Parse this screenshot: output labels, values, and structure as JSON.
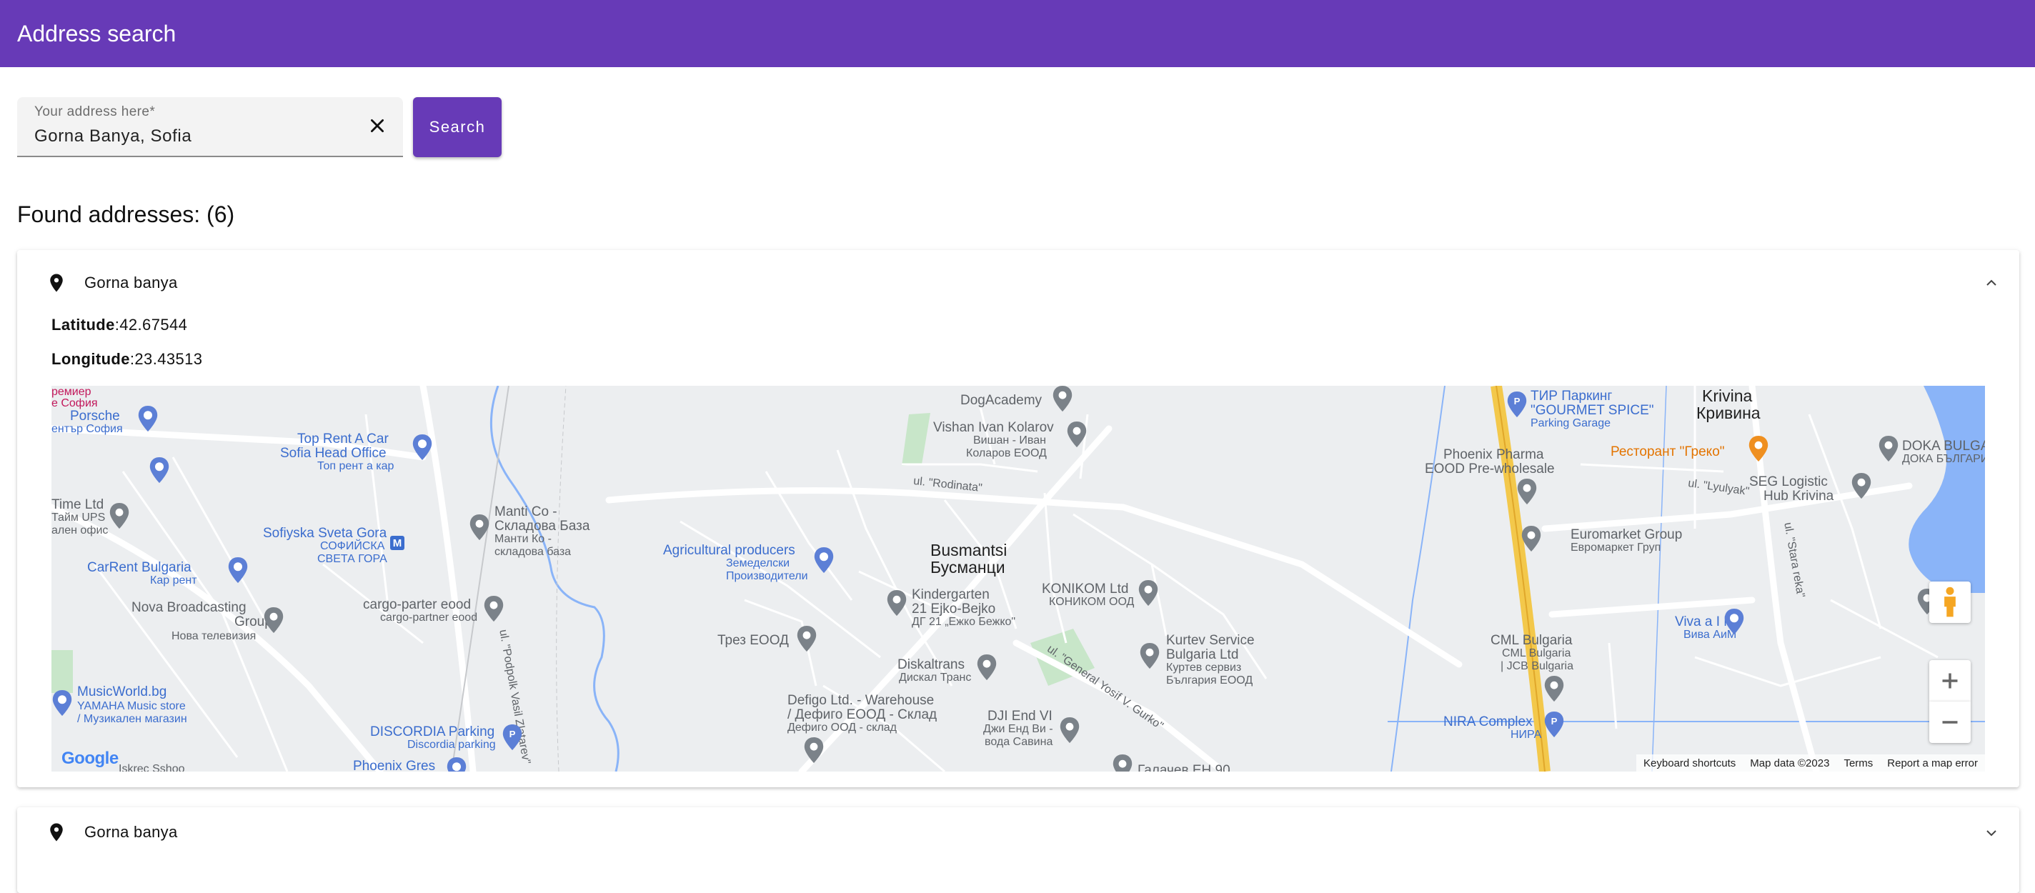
{
  "header": {
    "title": "Address search"
  },
  "search": {
    "label": "Your address here*",
    "value": "Gorna Banya, Sofia",
    "button_label": "Search"
  },
  "results": {
    "heading": "Found addresses: (6)",
    "items": [
      {
        "title": "Gorna banya",
        "latitude_label": "Latitude",
        "latitude": ":42.67544",
        "longitude_label": "Longitude",
        "longitude": ":23.43513",
        "expanded": true
      },
      {
        "title": "Gorna banya",
        "expanded": false
      }
    ]
  },
  "map": {
    "footer": {
      "shortcuts": "Keyboard shortcuts",
      "data": "Map data ©2023",
      "terms": "Terms",
      "report": "Report a map error"
    },
    "google_logo": "Google",
    "labels": {
      "premier": "ремиер",
      "premier_sofia": "е София",
      "porsche": "Porsche",
      "porsche_sub": "ентър София",
      "toprent": "Top Rent A Car",
      "toprent2": "Sofia Head Office",
      "toprent_sub": "Топ рент а кар",
      "timeltd": "Time Ltd",
      "timeltd_sub": "Тайм UPS",
      "timeltd_sub2": "ален офис",
      "sveta": "Sofiyska Sveta Gora",
      "sveta_sub": "СОФИЙСКА",
      "sveta_sub2": "СВЕТА ГОРА",
      "manti": "Manti Co -",
      "manti2": "Складова База",
      "manti_sub": "Манти Ко -",
      "manti_sub2": "складова база",
      "carrent": "CarRent Bulgaria",
      "carrent_sub": "Кар рент",
      "nova": "Nova Broadcasting",
      "nova2": "Group",
      "nova_sub": "Нова телевизия",
      "cargo": "cargo-parter eood",
      "cargo_sub": "cargo-partner eood",
      "podpolk": "ul. \"Podpolk Vasil Zlatarev\"",
      "music": "MusicWorld.bg",
      "music_sub": "YAMAHA Music store",
      "music_sub2": "/ Музикален магазин",
      "discordia": "DISCORDIA Parking",
      "discordia_sub": "Discordia parking",
      "phoenix": "Phoenix Gres",
      "iskrec": "Iskrec Sshoo",
      "dog": "DogAcademy",
      "vishan": "Vishan Ivan Kolarov",
      "vishan_sub": "Вишан - Иван",
      "vishan_sub2": "Коларов ЕООД",
      "rodinata": "ul. \"Rodinata\"",
      "agri": "Agricultural producers",
      "agri_sub": "Земеделски",
      "agri_sub2": "Производители",
      "busmantsi": "Busmantsi",
      "busmantsi_bg": "Бусманци",
      "kinder": "Kindergarten",
      "kinder2": "21 Ejko-Bejko",
      "kinder_sub": "ДГ 21 „Ежко Бежко\"",
      "konikom": "KONIKOM Ltd",
      "konikom_sub": "КОНИКОМ ООД",
      "trez": "Трез ЕООД",
      "diskal": "Diskaltrans",
      "diskal_sub": "Дискал Транс",
      "gurko": "ul. \"General Yosif V. Gurko\"",
      "defigo": "Defigo Ltd. - Warehouse",
      "defigo2": "/ Дефиго ЕООД - Склад",
      "defigo_sub": "Дефиго ООД - склад",
      "djiend": "DJI End VI",
      "djiend_sub": "Джи Енд Ви -",
      "djiend_sub2": "вода Савина",
      "kurtev": "Kurtev Service",
      "kurtev2": "Bulgaria Ltd",
      "kurtev_sub": "Куртев сервиз",
      "kurtev_sub2": "България ЕООД",
      "galachev": "Галачев ЕН 90",
      "tir": "ТИР Паркинг",
      "tir2": "\"GOURMET SPICE\"",
      "tir_sub": "Parking Garage",
      "krivina": "Krivina",
      "krivina_bg": "Кривина",
      "greko": "Ресторант \"Греко\"",
      "doka": "DOKA BULGARIA",
      "doka_sub": "ДОКА БЪЛГАРИЯ",
      "phoenixph": "Phoenix Pharma",
      "phoenixph2": "EOOD Pre-wholesale",
      "lyulyak": "ul. \"Lyulyak\"",
      "seg": "SEG Logistic",
      "seg2": "Hub Krivina",
      "euromarket": "Euromarket Group",
      "euromarket_sub": "Евромаркет Груп",
      "starareka": "ul. \"Stara reka\"",
      "viva": "Viva a I M",
      "viva_sub": "Вива АиМ",
      "cml": "CML Bulgaria",
      "cml_sub": "CML Bulgaria",
      "cml_sub2": "| JCB Bulgaria",
      "nira": "NIRA Complex",
      "nira_sub": "НИРА"
    }
  },
  "colors": {
    "primary": "#673ab7",
    "map_bg": "#eceef0",
    "water": "#8ab4f8",
    "highway": "#f3c84b",
    "park": "#c8e6c9"
  }
}
